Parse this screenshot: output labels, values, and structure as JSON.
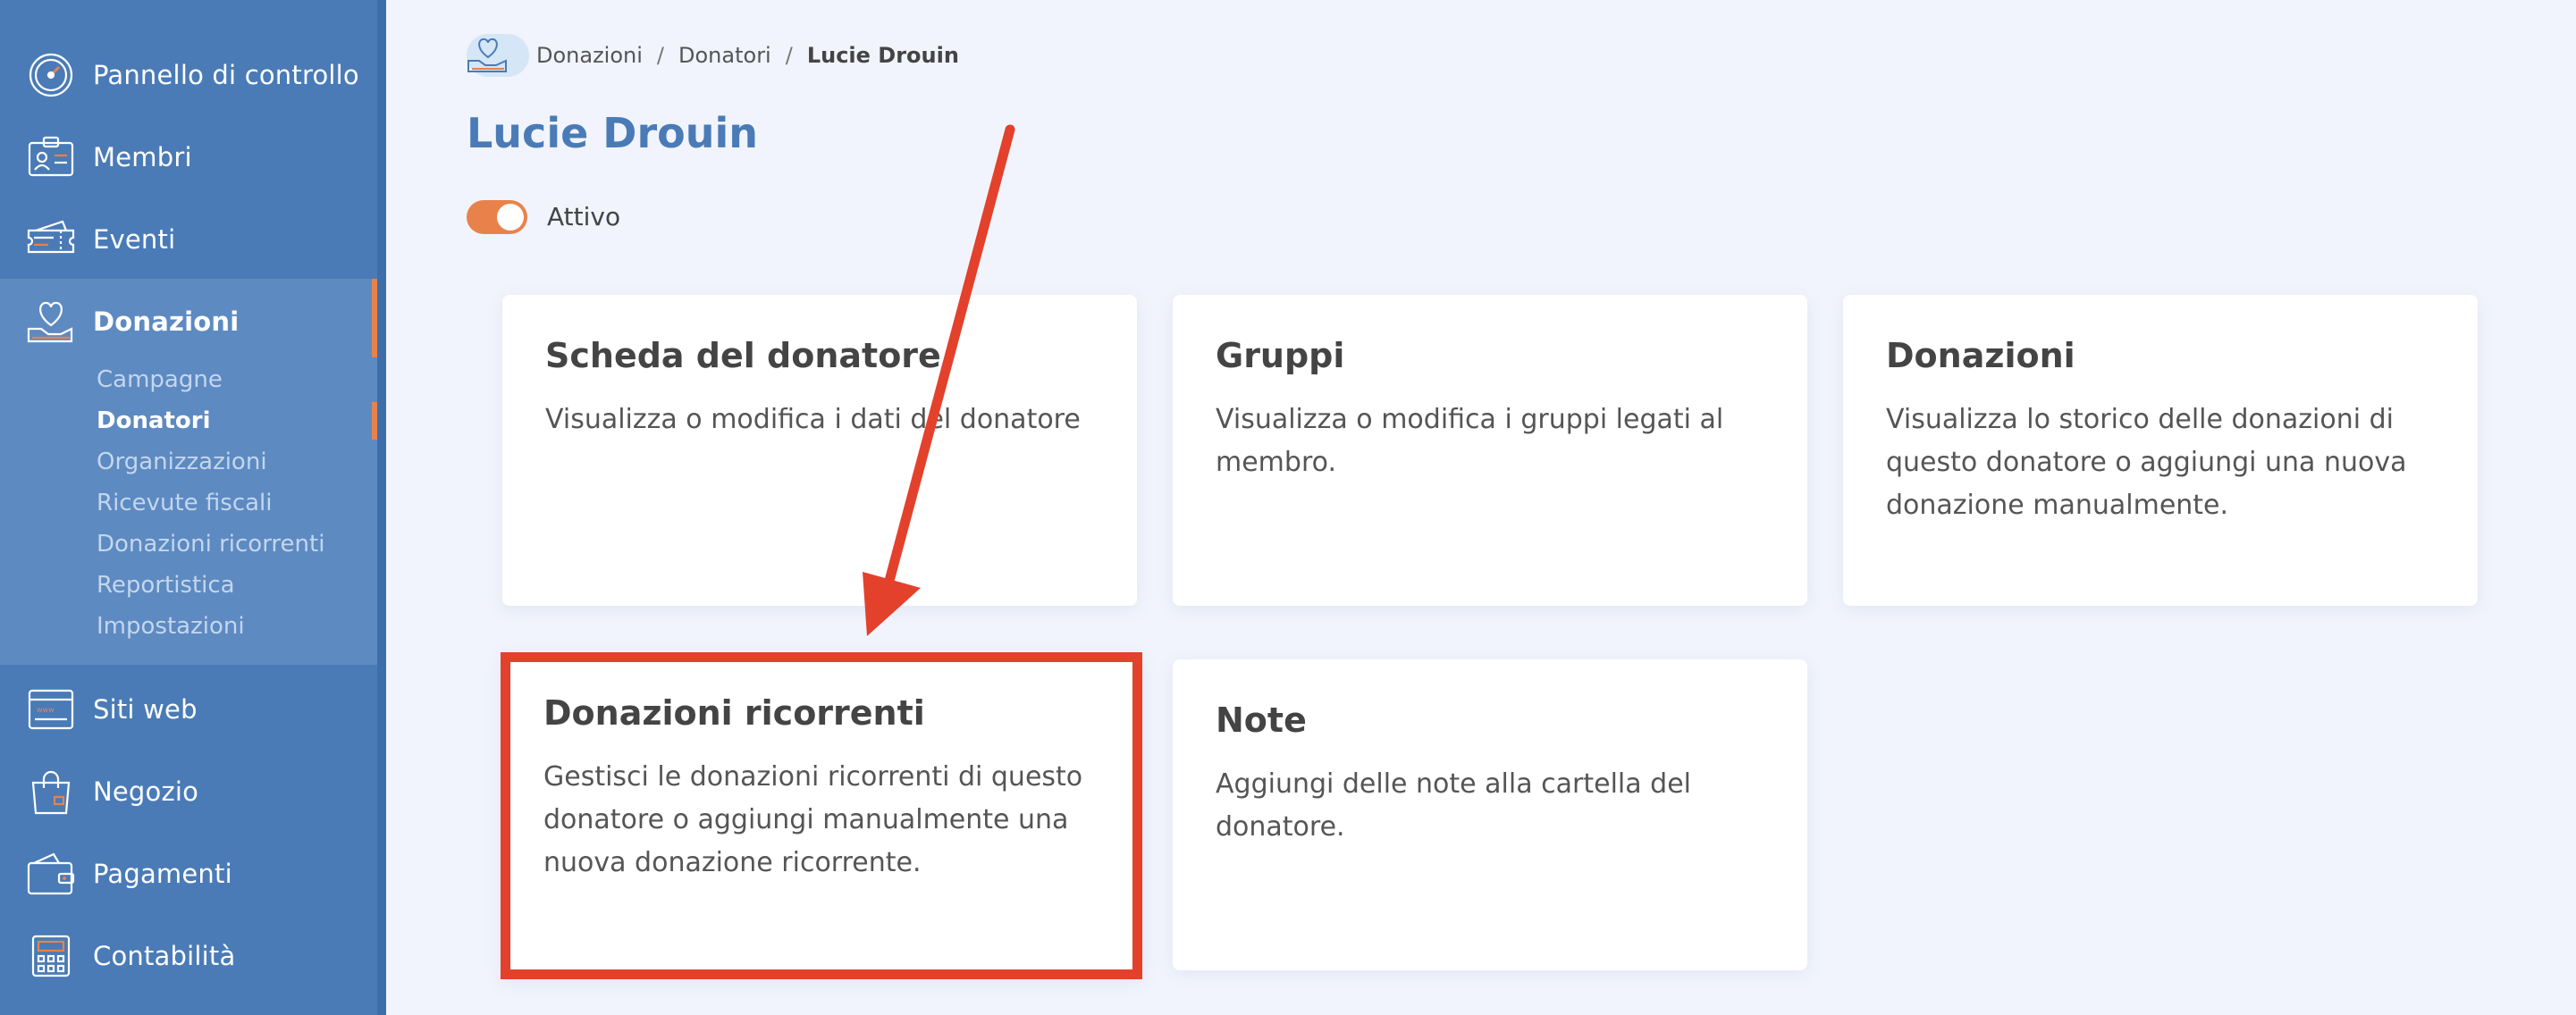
{
  "sidebar": {
    "items": [
      {
        "label": "Pannello di controllo",
        "icon": "speedometer-icon"
      },
      {
        "label": "Membri",
        "icon": "id-card-icon"
      },
      {
        "label": "Eventi",
        "icon": "ticket-icon"
      },
      {
        "label": "Donazioni",
        "icon": "heart-hand-icon"
      },
      {
        "label": "Siti web",
        "icon": "browser-window-icon"
      },
      {
        "label": "Negozio",
        "icon": "shopping-bag-icon"
      },
      {
        "label": "Pagamenti",
        "icon": "wallet-icon"
      },
      {
        "label": "Contabilità",
        "icon": "calculator-icon"
      }
    ],
    "submenu": [
      {
        "label": "Campagne"
      },
      {
        "label": "Donatori"
      },
      {
        "label": "Organizzazioni"
      },
      {
        "label": "Ricevute fiscali"
      },
      {
        "label": "Donazioni ricorrenti"
      },
      {
        "label": "Reportistica"
      },
      {
        "label": "Impostazioni"
      }
    ]
  },
  "breadcrumb": {
    "items": [
      "Donazioni",
      "Donatori"
    ],
    "current": "Lucie Drouin",
    "separator": "/"
  },
  "page": {
    "title": "Lucie Drouin",
    "status_label": "Attivo",
    "status_on": true
  },
  "cards": [
    {
      "title": "Scheda del donatore",
      "description": "Visualizza o modifica i dati del donatore"
    },
    {
      "title": "Gruppi",
      "description": "Visualizza o modifica i gruppi legati al membro."
    },
    {
      "title": "Donazioni",
      "description": "Visualizza lo storico delle donazioni di questo donatore o aggiungi una nuova donazione manualmente."
    },
    {
      "title": "Donazioni ricorrenti",
      "description": "Gestisci le donazioni ricorrenti di questo donatore o aggiungi manualmente una nuova donazione ricorrente."
    },
    {
      "title": "Note",
      "description": "Aggiungi delle note alla cartella del donatore."
    }
  ],
  "colors": {
    "sidebar": "#4a7bb6",
    "accent": "#e9824a",
    "highlight": "#e3412c",
    "title": "#4a7bb6"
  }
}
